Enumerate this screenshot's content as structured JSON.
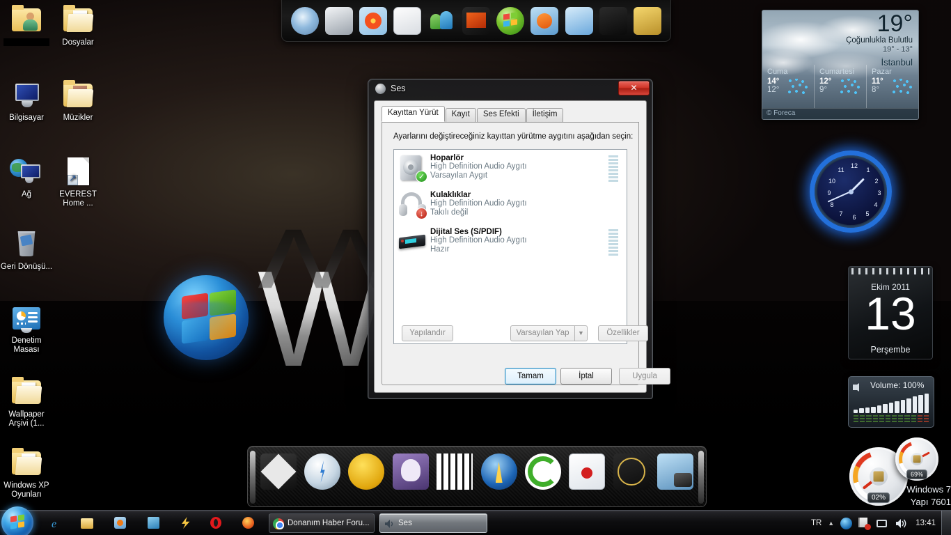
{
  "desktop": {
    "icons": [
      {
        "label": "",
        "redacted": true,
        "icon": "user-folder-icon"
      },
      {
        "label": "Dosyalar",
        "redacted": false,
        "icon": "folder-documents-icon"
      },
      {
        "label": "Bilgisayar",
        "redacted": false,
        "icon": "computer-icon"
      },
      {
        "label": "Müzikler",
        "redacted": false,
        "icon": "folder-music-icon"
      },
      {
        "label": "Ağ",
        "redacted": false,
        "icon": "network-icon"
      },
      {
        "label": "EVEREST Home ...",
        "redacted": false,
        "icon": "everest-shortcut-icon"
      },
      {
        "label": "Geri Dönüşü...",
        "redacted": false,
        "icon": "recycle-bin-icon"
      },
      {
        "label": "Denetim Masası",
        "redacted": false,
        "icon": "control-panel-icon"
      },
      {
        "label": "Wallpaper Arşivi (1...",
        "redacted": false,
        "icon": "folder-icon"
      },
      {
        "label": "Windows XP Oyunları",
        "redacted": false,
        "icon": "folder-icon"
      }
    ],
    "wallpaper_word": "W"
  },
  "top_dock": {
    "items": [
      {
        "name": "disc-burner-icon"
      },
      {
        "name": "fax-scan-icon"
      },
      {
        "name": "photo-gallery-icon"
      },
      {
        "name": "mail-icon"
      },
      {
        "name": "messenger-icon"
      },
      {
        "name": "movie-maker-icon"
      },
      {
        "name": "windows-logo-icon"
      },
      {
        "name": "media-player-icon"
      },
      {
        "name": "media-center-icon"
      },
      {
        "name": "tshirt-icon"
      },
      {
        "name": "tools-icon"
      }
    ]
  },
  "bottom_dock": {
    "items": [
      {
        "name": "nexus-icon"
      },
      {
        "name": "lightning-icon"
      },
      {
        "name": "emoticon-headphones-icon"
      },
      {
        "name": "owl-icon"
      },
      {
        "name": "piano-icon"
      },
      {
        "name": "aimp-icon"
      },
      {
        "name": "sync-icon"
      },
      {
        "name": "mail-alert-icon"
      },
      {
        "name": "facebook-globe-icon"
      },
      {
        "name": "camera-photo-icon"
      }
    ]
  },
  "gadgets": {
    "weather": {
      "temp": "19°",
      "condition": "Çoğunlukla Bulutlu",
      "hilo": "19°  -  13°",
      "city": "İstanbul",
      "source": "© Foreca",
      "forecast": [
        {
          "day": "Cuma",
          "high": "14°",
          "low": "12°",
          "icon": "rain-icon"
        },
        {
          "day": "Cumartesi",
          "high": "12°",
          "low": "9°",
          "icon": "rain-icon"
        },
        {
          "day": "Pazar",
          "high": "11°",
          "low": "8°",
          "icon": "rain-icon"
        }
      ]
    },
    "clock": {
      "numbers": [
        "12",
        "1",
        "2",
        "3",
        "4",
        "5",
        "6",
        "7",
        "8",
        "9",
        "10",
        "11"
      ]
    },
    "calendar": {
      "month": "Ekim 2011",
      "day": "13",
      "weekday": "Perşembe"
    },
    "volume": {
      "title": "Volume: 100%"
    },
    "meters": {
      "cpu": "02%",
      "ram": "69%",
      "os_line1": "Windows 7",
      "os_line2": "Yapı 7601"
    }
  },
  "sound_dialog": {
    "title": "Ses",
    "close_label": "✕",
    "tabs": [
      {
        "label": "Kayıttan Yürüt",
        "active": true
      },
      {
        "label": "Kayıt",
        "active": false
      },
      {
        "label": "Ses Efekti",
        "active": false
      },
      {
        "label": "İletişim",
        "active": false
      }
    ],
    "instruction": "Ayarlarını değiştireceğiniz kayıttan yürütme aygıtını aşağıdan seçin:",
    "devices": [
      {
        "name": "Hoparlör",
        "driver": "High Definition Audio Aygıtı",
        "status": "Varsayılan Aygıt",
        "badge": "default",
        "icon": "speaker-icon",
        "has_meter": true
      },
      {
        "name": "Kulaklıklar",
        "driver": "High Definition Audio Aygıtı",
        "status": "Takılı değil",
        "badge": "unplugged",
        "icon": "headphones-icon",
        "has_meter": false
      },
      {
        "name": "Dijital Ses (S/PDIF)",
        "driver": "High Definition Audio Aygıtı",
        "status": "Hazır",
        "badge": "none",
        "icon": "spdif-icon",
        "has_meter": true
      }
    ],
    "buttons": {
      "configure": "Yapılandır",
      "set_default": "Varsayılan Yap",
      "set_default_arrow": "▼",
      "properties": "Özellikler",
      "ok": "Tamam",
      "cancel": "İptal",
      "apply": "Uygula"
    }
  },
  "taskbar": {
    "start": "start-orb",
    "quick_launch": [
      {
        "name": "internet-explorer-icon"
      },
      {
        "name": "explorer-folder-icon"
      },
      {
        "name": "media-player-icon"
      },
      {
        "name": "defrag-icon"
      },
      {
        "name": "lightning-icon"
      },
      {
        "name": "opera-icon"
      },
      {
        "name": "firefox-icon"
      }
    ],
    "windows": [
      {
        "label": "Donanım Haber Foru...",
        "icon": "chrome-icon",
        "active": false
      },
      {
        "label": "Ses",
        "icon": "speaker-small-icon",
        "active": true
      }
    ],
    "tray": {
      "language": "TR",
      "chevron": "▲",
      "icons": [
        {
          "name": "avast-icon"
        },
        {
          "name": "flag-alert-icon"
        },
        {
          "name": "network-tray-icon"
        },
        {
          "name": "volume-tray-icon"
        }
      ],
      "clock": "13:41"
    }
  },
  "colors": {
    "accent_blue": "#2c8ec4",
    "close_red": "#cf3427",
    "default_green": "#1f8f1a",
    "unplug_red": "#b3180a"
  }
}
